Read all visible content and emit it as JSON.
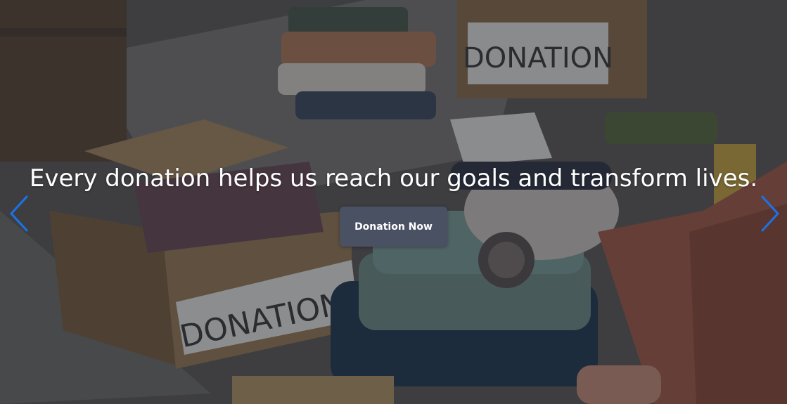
{
  "hero": {
    "headline": "Every donation helps us reach our goals and transform lives.",
    "cta_label": "Donation Now",
    "box_label_front": "DONATION",
    "box_label_back": "DONATION"
  },
  "carousel": {
    "prev_icon": "chevron-left-icon",
    "next_icon": "chevron-right-icon"
  },
  "colors": {
    "arrow": "#1a73e8",
    "button_bg": "#4a5163",
    "text": "#ffffff"
  }
}
